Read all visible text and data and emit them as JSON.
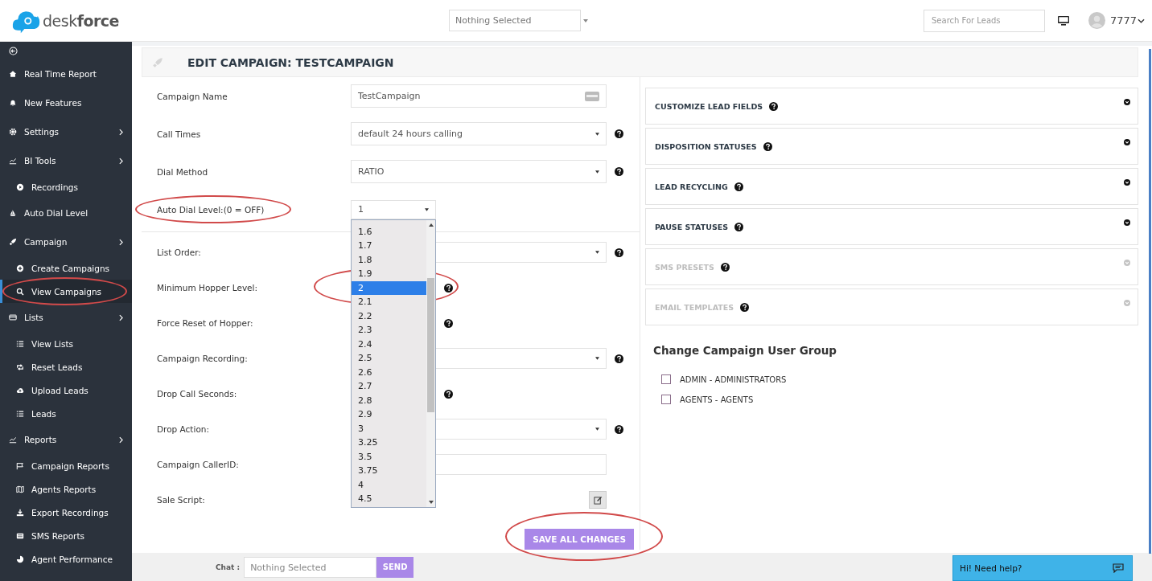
{
  "header": {
    "logo": "desk**force**",
    "filter": {
      "value": "Nothing Selected"
    },
    "search": {
      "placeholder": "Search For Leads"
    },
    "user": "7777"
  },
  "sidebar": {
    "items": [
      {
        "label": "Real Time Report",
        "chevron": false
      },
      {
        "label": "New Features",
        "chevron": false
      },
      {
        "label": "Settings",
        "chevron": true
      },
      {
        "label": "BI Tools",
        "chevron": true,
        "children": [
          {
            "label": "Recordings",
            "selected": false
          }
        ]
      },
      {
        "label": "Auto Dial Level",
        "chevron": false
      },
      {
        "label": "Campaign",
        "chevron": true,
        "children": [
          {
            "label": "Create Campaigns",
            "selected": false
          },
          {
            "label": "View Campaigns",
            "selected": true
          }
        ]
      },
      {
        "label": "Lists",
        "chevron": true,
        "children": [
          {
            "label": "View Lists",
            "selected": false
          },
          {
            "label": "Reset Leads",
            "selected": false
          },
          {
            "label": "Upload Leads",
            "selected": false
          },
          {
            "label": "Leads",
            "selected": false
          }
        ]
      },
      {
        "label": "Reports",
        "chevron": true,
        "children": [
          {
            "label": "Campaign Reports",
            "selected": false
          },
          {
            "label": "Agents Reports",
            "selected": false
          },
          {
            "label": "Export Recordings",
            "selected": false
          },
          {
            "label": "SMS Reports",
            "selected": false
          },
          {
            "label": "Agent Performance",
            "selected": false
          }
        ]
      }
    ]
  },
  "form": {
    "title": "EDIT CAMPAIGN: TESTCAMPAIGN",
    "sections": [
      [
        {
          "label": "Campaign Name",
          "kind": "text",
          "value": "TestCampaign",
          "help": false
        },
        {
          "label": "Call Times",
          "kind": "select",
          "value": "default 24 hours calling",
          "help": true
        },
        {
          "label": "Dial Method",
          "kind": "select",
          "value": "RATIO",
          "help": true
        },
        {
          "label": "Auto Dial Level:(0 = OFF)",
          "kind": "dropdown",
          "value": "1",
          "expanded": true,
          "help": false,
          "options": [
            {
              "label": "1.6",
              "selected": false
            },
            {
              "label": "1.7",
              "selected": false
            },
            {
              "label": "1.8",
              "selected": false
            },
            {
              "label": "1.9",
              "selected": false
            },
            {
              "label": "2",
              "selected": true
            },
            {
              "label": "2.1",
              "selected": false
            },
            {
              "label": "2.2",
              "selected": false
            },
            {
              "label": "2.3",
              "selected": false
            },
            {
              "label": "2.4",
              "selected": false
            },
            {
              "label": "2.5",
              "selected": false
            },
            {
              "label": "2.6",
              "selected": false
            },
            {
              "label": "2.7",
              "selected": false
            },
            {
              "label": "2.8",
              "selected": false
            },
            {
              "label": "2.9",
              "selected": false
            },
            {
              "label": "3",
              "selected": false
            },
            {
              "label": "3.25",
              "selected": false
            },
            {
              "label": "3.5",
              "selected": false
            },
            {
              "label": "3.75",
              "selected": false
            },
            {
              "label": "4",
              "selected": false
            },
            {
              "label": "4.5",
              "selected": false
            }
          ]
        }
      ],
      [
        {
          "label": "List Order:",
          "kind": "select",
          "help": true
        },
        {
          "label": "Minimum Hopper Level:",
          "kind": "short",
          "help": true
        },
        {
          "label": "Force Reset of Hopper:",
          "kind": "short",
          "help": true
        },
        {
          "label": "Campaign Recording:",
          "kind": "select",
          "help": true
        },
        {
          "label": "Drop Call Seconds:",
          "kind": "short",
          "help": true
        },
        {
          "label": "Drop Action:",
          "kind": "select",
          "help": true
        },
        {
          "label": "Campaign CallerID:",
          "kind": "input",
          "help": false
        },
        {
          "label": "Sale Script:",
          "kind": "script",
          "help": false
        }
      ]
    ],
    "save_button": "SAVE ALL CHANGES"
  },
  "panels": [
    {
      "title": "CUSTOMIZE LEAD FIELDS",
      "disabled": false
    },
    {
      "title": "DISPOSITION STATUSES",
      "disabled": false
    },
    {
      "title": "LEAD RECYCLING",
      "disabled": false
    },
    {
      "title": "PAUSE STATUSES",
      "disabled": false
    },
    {
      "title": "SMS PRESETS",
      "disabled": true
    },
    {
      "title": "EMAIL TEMPLATES",
      "disabled": true
    }
  ],
  "user_group": {
    "title": "Change Campaign User Group",
    "options": [
      {
        "label": "ADMIN - ADMINISTRATORS",
        "checked": false
      },
      {
        "label": "AGENTS - AGENTS",
        "checked": false
      }
    ]
  },
  "chat": {
    "label": "Chat :",
    "select": {
      "placeholder": "Nothing Selected"
    },
    "send_button": "SEND",
    "widget": "Hi! Need help?"
  }
}
